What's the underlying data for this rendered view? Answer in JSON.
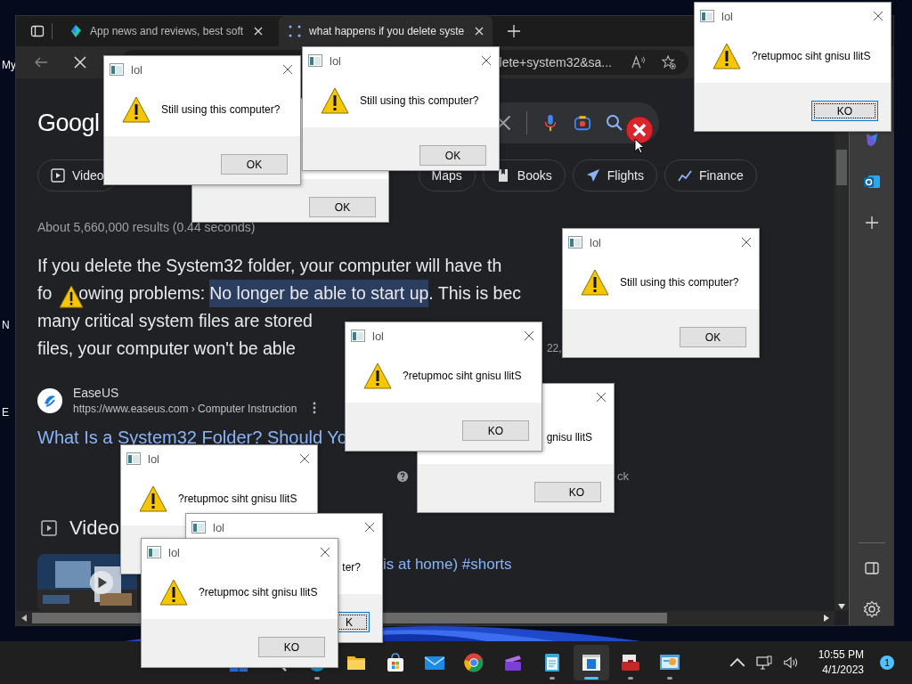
{
  "desktop_icons": [
    {
      "label": "My"
    },
    {
      "label": "N"
    },
    {
      "label": "E"
    }
  ],
  "browser": {
    "tabs": [
      {
        "title": "App news and reviews, best soft",
        "selected": false
      },
      {
        "title": "what happens if you delete syste",
        "selected": true
      }
    ],
    "address": "lete+system32&sa...",
    "logo": "Googl",
    "chips": [
      "Video",
      "Maps",
      "Books",
      "Flights",
      "Finance"
    ],
    "result_stats": "About 5,660,000 results (0.44 seconds)",
    "snippet": {
      "line_1": "If you delete the System32 folder, your computer will have th",
      "line_2_start": "fo",
      "line_2_before": "owing problems:",
      "highlight": "No longer be able to start up",
      "line_2_after": ". This is bec",
      "line_3": "many critical system files are stored",
      "line_4": "files, your computer won't be able",
      "date": "22,"
    },
    "result": {
      "site": "EaseUS",
      "url": "https://www.easeus.com › Computer Instruction",
      "title": "What Is a System32 Folder? Should Yo"
    },
    "feedback_fragment": "ck",
    "videos_heading": "Video",
    "video": {
      "kind": "picture",
      "title": "is at home) #shorts"
    }
  },
  "dialogs": [
    {
      "kind": "buried",
      "button": "OK",
      "focused": false
    },
    {
      "kind": "full",
      "title": "lol",
      "message": "Still using this computer?",
      "button": "OK",
      "focused": false
    },
    {
      "kind": "full",
      "title": "lol",
      "message": "Still using this computer?",
      "button": "OK",
      "focused": false
    },
    {
      "kind": "full",
      "title": "lol",
      "message": "?retupmoc siht gnisu llitS",
      "button": "KO",
      "focused": true
    },
    {
      "kind": "full",
      "title": "lol",
      "message": "Still using this computer?",
      "button": "OK",
      "focused": false
    },
    {
      "kind": "covered",
      "message": "gnisu llitS",
      "button": "KO",
      "focused": false
    },
    {
      "kind": "full",
      "title": "lol",
      "message": "?retupmoc siht gnisu llitS",
      "button": "KO",
      "focused": false
    },
    {
      "kind": "full",
      "title": "lol",
      "message": "?retupmoc siht gnisu llitS"
    },
    {
      "kind": "covered",
      "title": "lol",
      "message": "ter?",
      "button": "K",
      "focused": true
    },
    {
      "kind": "full",
      "title": "lol",
      "message": "?retupmoc siht gnisu llitS",
      "button": "KO",
      "focused": false
    }
  ],
  "taskbar": {
    "apps": [
      {
        "running": false,
        "selected": false
      },
      {
        "running": false,
        "selected": false
      },
      {
        "running": true,
        "selected": false
      },
      {
        "running": false,
        "selected": false
      },
      {
        "running": false,
        "selected": false
      },
      {
        "running": false,
        "selected": false
      },
      {
        "running": false,
        "selected": false
      },
      {
        "running": false,
        "selected": false
      },
      {
        "running": true,
        "selected": false
      },
      {
        "running": true,
        "selected": true
      },
      {
        "running": true,
        "selected": false
      },
      {
        "running": true,
        "selected": false
      }
    ],
    "time": "10:55 PM",
    "date": "4/1/2023",
    "notifications": "1"
  }
}
